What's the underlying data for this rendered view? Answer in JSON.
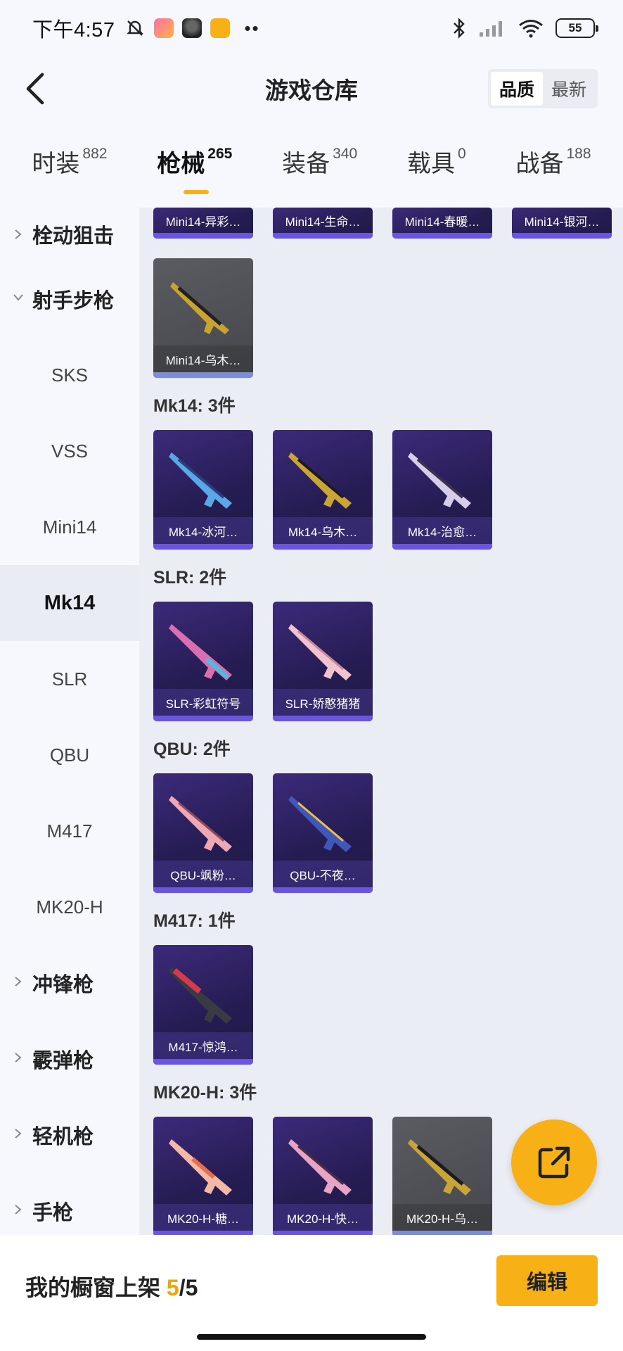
{
  "status": {
    "time": "下午4:57",
    "battery": "55"
  },
  "header": {
    "title": "游戏仓库",
    "sort_quality": "品质",
    "sort_latest": "最新"
  },
  "tabs": [
    {
      "label": "时装",
      "count": "882"
    },
    {
      "label": "枪械",
      "count": "265"
    },
    {
      "label": "装备",
      "count": "340"
    },
    {
      "label": "载具",
      "count": "0"
    },
    {
      "label": "战备",
      "count": "188"
    }
  ],
  "sidebar": {
    "bolt_sniper": "栓动狙击",
    "marksman": "射手步枪",
    "subs": [
      "SKS",
      "VSS",
      "Mini14",
      "Mk14",
      "SLR",
      "QBU",
      "M417",
      "MK20-H"
    ],
    "smg": "冲锋枪",
    "shotgun": "霰弹枪",
    "lmg": "轻机枪",
    "pistol": "手枪"
  },
  "top_row": [
    "Mini14-异彩…",
    "Mini14-生命…",
    "Mini14-春暖…",
    "Mini14-银河…"
  ],
  "mini14_extra": "Mini14-乌木…",
  "sections": {
    "mk14": {
      "title": "Mk14: 3件",
      "items": [
        "Mk14-冰河…",
        "Mk14-乌木…",
        "Mk14-治愈…"
      ]
    },
    "slr": {
      "title": "SLR: 2件",
      "items": [
        "SLR-彩虹符号",
        "SLR-娇憨猪猪"
      ]
    },
    "qbu": {
      "title": "QBU: 2件",
      "items": [
        "QBU-飒粉…",
        "QBU-不夜…"
      ]
    },
    "m417": {
      "title": "M417: 1件",
      "items": [
        "M417-惊鸿…"
      ]
    },
    "mk20h": {
      "title": "MK20-H: 3件",
      "items": [
        "MK20-H-糖…",
        "MK20-H-快…",
        "MK20-H-乌…"
      ]
    }
  },
  "bottom": {
    "showcase_label": "我的橱窗上架",
    "showcase_count": "5",
    "showcase_total": "/5",
    "edit": "编辑"
  },
  "colors": {
    "accent": "#f7b117",
    "card_purple": "#2d2262",
    "card_gray": "#4d4f55"
  }
}
